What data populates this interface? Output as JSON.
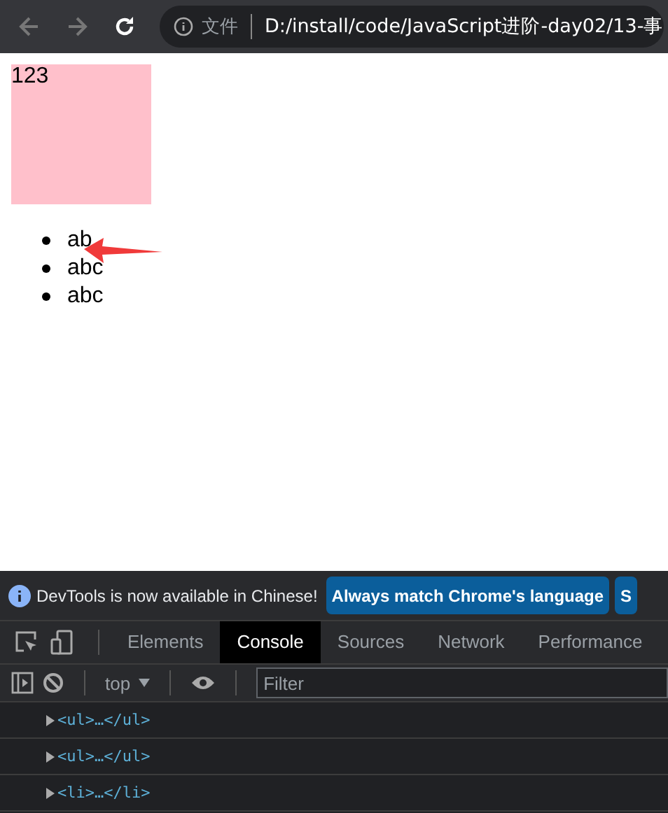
{
  "browser": {
    "address_label": "文件",
    "url": "D:/install/code/JavaScript进阶-day02/13-事"
  },
  "page": {
    "box_text": "123",
    "list_items": [
      "ab",
      "abc",
      "abc"
    ]
  },
  "devtools": {
    "notice": "DevTools is now available in Chinese!",
    "notice_buttons": [
      "Always match Chrome's language",
      "S"
    ],
    "tabs": [
      {
        "label": "Elements",
        "selected": false
      },
      {
        "label": "Console",
        "selected": true
      },
      {
        "label": "Sources",
        "selected": false
      },
      {
        "label": "Network",
        "selected": false
      },
      {
        "label": "Performance",
        "selected": false
      }
    ],
    "context": "top",
    "filter": {
      "placeholder": "Filter"
    },
    "console_rows": [
      {
        "text": "<ul>…</ul>",
        "expanded": false
      },
      {
        "text": "<ul>…</ul>",
        "expanded": false
      },
      {
        "text": "<li>…</li>",
        "expanded": false
      }
    ]
  }
}
